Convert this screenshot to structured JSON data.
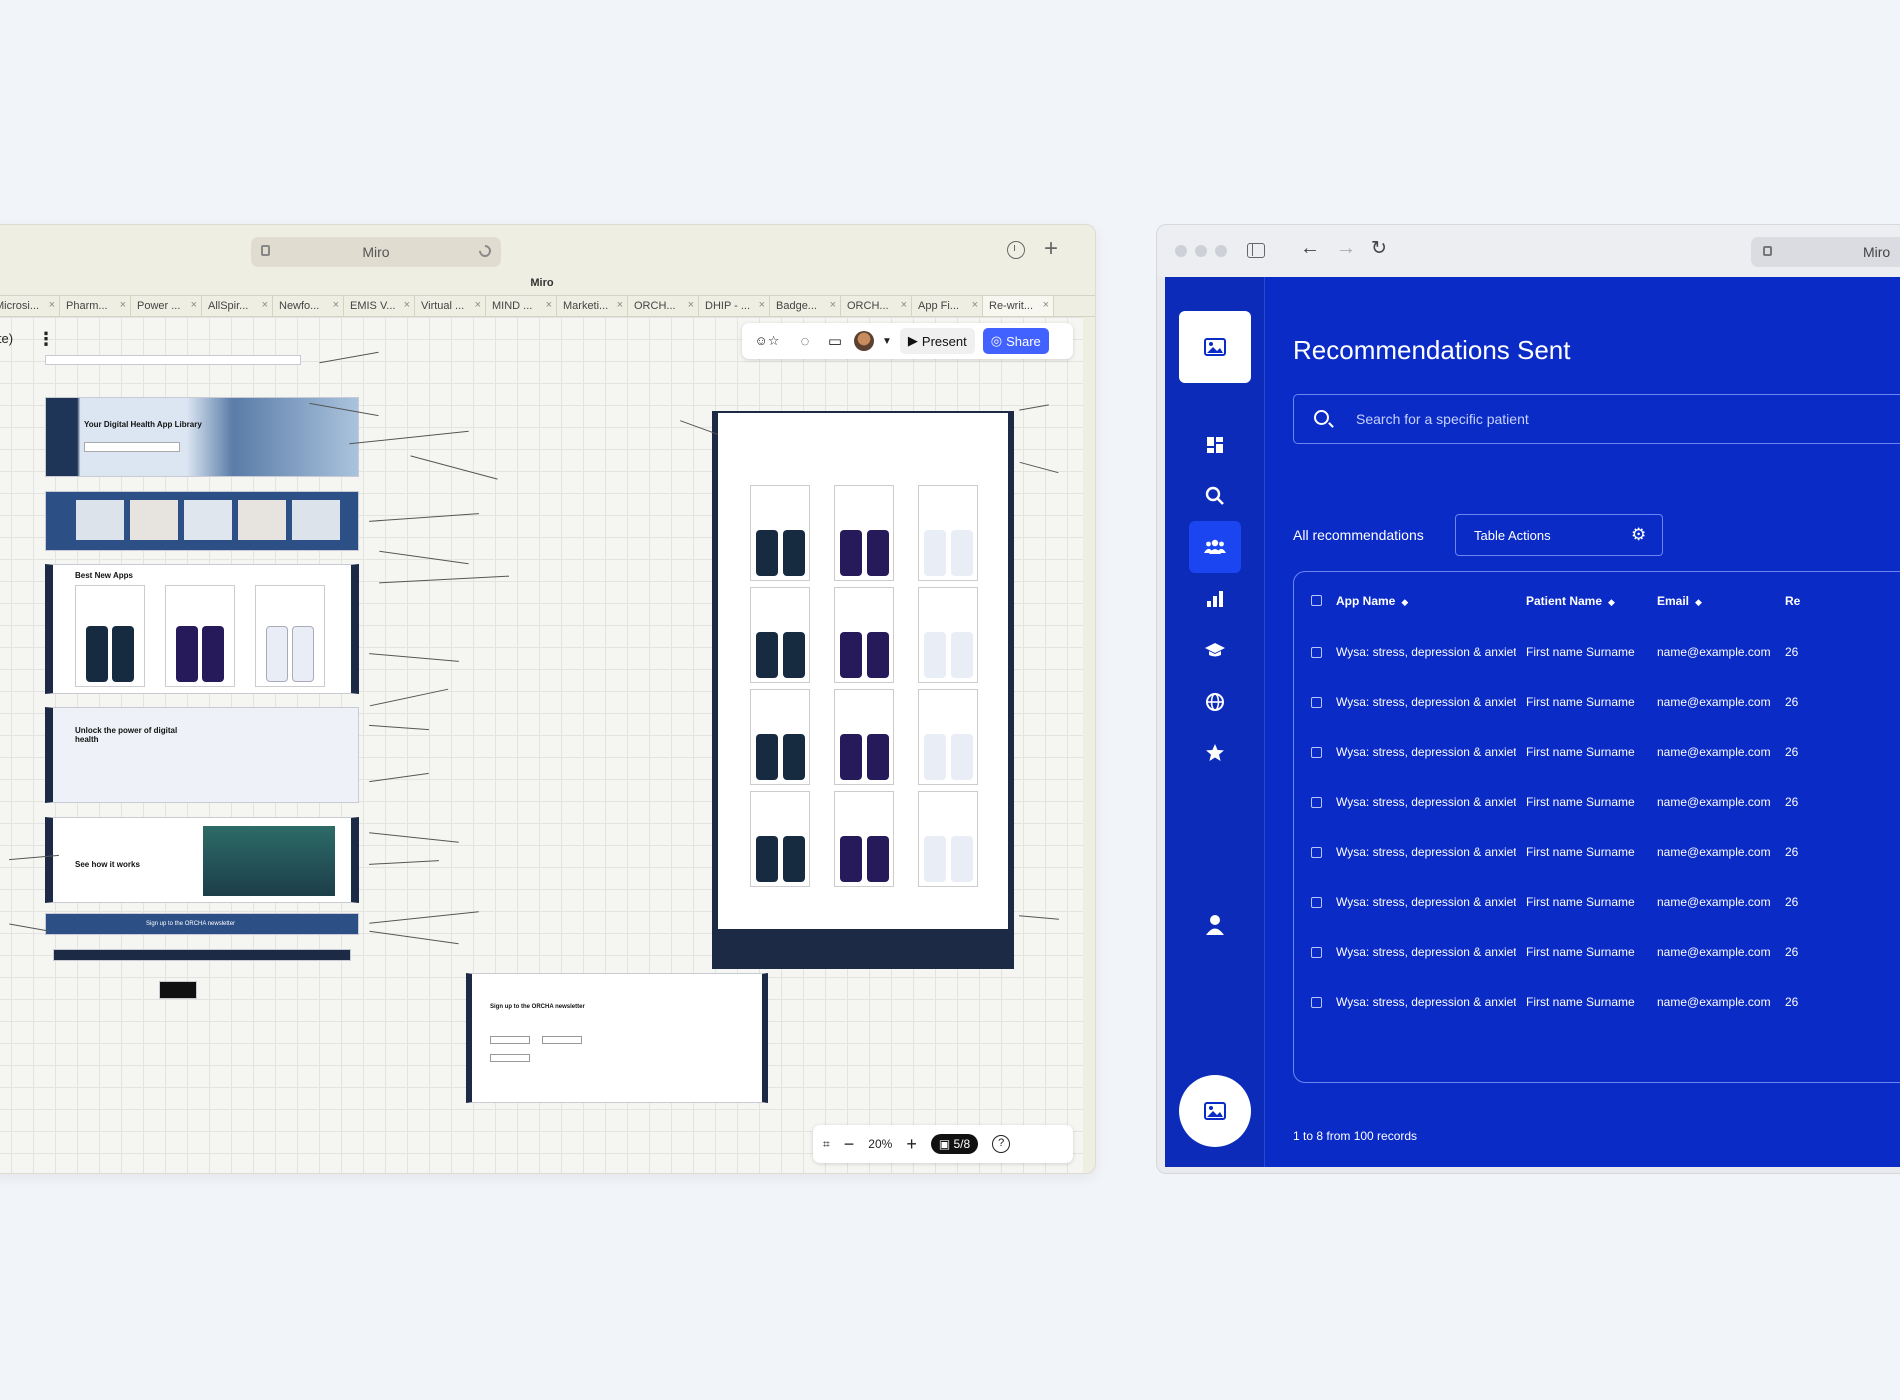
{
  "miro": {
    "address": "Miro",
    "window_title": "Miro",
    "tabs": [
      "Microsi...",
      "Pharm...",
      "Power ...",
      "AllSpir...",
      "Newfo...",
      "EMIS V...",
      "Virtual ...",
      "MIND ...",
      "Marketi...",
      "ORCH...",
      "DHIP - ...",
      "Badge...",
      "ORCH...",
      "App Fi...",
      "Re-writ..."
    ],
    "board_name": "ite)",
    "toolbar": {
      "present": "Present",
      "share": "Share"
    },
    "zoom": "20%",
    "page_counter": "5/8",
    "wireframe": {
      "hero_title": "Your Digital Health App Library",
      "section_new_apps": "Best New Apps",
      "section_unlock": "Unlock the power of digital health",
      "section_how": "See how it works",
      "newsletter": "Sign up to the ORCHA newsletter",
      "newsletter_form_title": "Sign up to the ORCHA newsletter"
    }
  },
  "browser": {
    "address": "Miro"
  },
  "app": {
    "title": "Recommendations Sent",
    "search_placeholder": "Search for a specific patient",
    "all_recommendations": "All recommendations",
    "table_actions": "Table Actions",
    "columns": [
      "App Name",
      "Patient Name",
      "Email",
      "Re"
    ],
    "rows": [
      {
        "app": "Wysa: stress, depression & anxiety...",
        "patient": "First name Surname",
        "email": "name@example.com",
        "date": "26"
      },
      {
        "app": "Wysa: stress, depression & anxiety...",
        "patient": "First name Surname",
        "email": "name@example.com",
        "date": "26"
      },
      {
        "app": "Wysa: stress, depression & anxiety...",
        "patient": "First name Surname",
        "email": "name@example.com",
        "date": "26"
      },
      {
        "app": "Wysa: stress, depression & anxiety...",
        "patient": "First name Surname",
        "email": "name@example.com",
        "date": "26"
      },
      {
        "app": "Wysa: stress, depression & anxiety...",
        "patient": "First name Surname",
        "email": "name@example.com",
        "date": "26"
      },
      {
        "app": "Wysa: stress, depression & anxiety...",
        "patient": "First name Surname",
        "email": "name@example.com",
        "date": "26"
      },
      {
        "app": "Wysa: stress, depression & anxiety...",
        "patient": "First name Surname",
        "email": "name@example.com",
        "date": "26"
      },
      {
        "app": "Wysa: stress, depression & anxiety...",
        "patient": "First name Surname",
        "email": "name@example.com",
        "date": "26"
      }
    ],
    "footer": "1 to 8 from 100 records"
  },
  "colors": {
    "app_blue": "#0a2bc6",
    "share_blue": "#4262ff",
    "canvas": "#f5f5f2"
  }
}
